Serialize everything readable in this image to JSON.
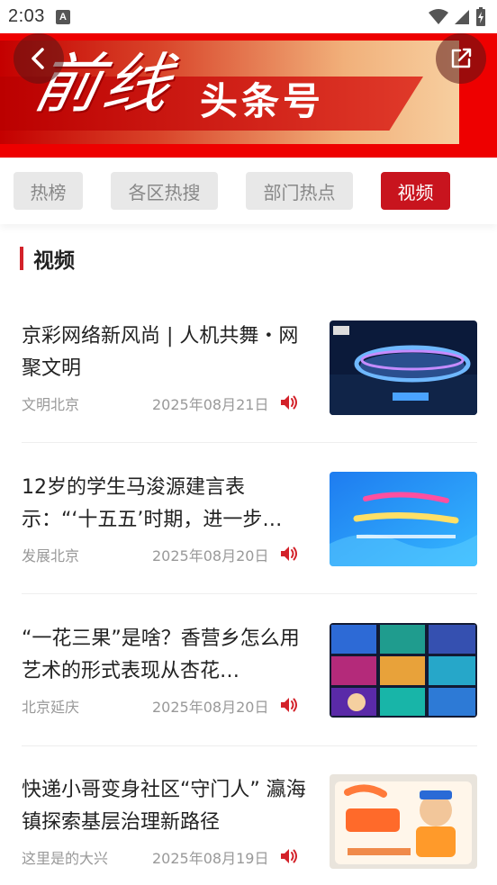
{
  "status_bar": {
    "time": "2:03",
    "a_badge": "A"
  },
  "banner": {
    "calligraphy": "前线",
    "title": "头条号"
  },
  "tabs": [
    {
      "label": "热榜",
      "active": false
    },
    {
      "label": "各区热搜",
      "active": false
    },
    {
      "label": "部门热点",
      "active": false
    },
    {
      "label": "视频",
      "active": true
    }
  ],
  "section": {
    "title": "视频"
  },
  "news": [
    {
      "title": "京彩网络新风尚 | 人机共舞・网聚文明",
      "source": "文明北京",
      "date": "2025年08月21日",
      "thumb": "stadium-night"
    },
    {
      "title": "12岁的学生马浚源建言表示：“‘十五五’时期，进一步…",
      "source": "发展北京",
      "date": "2025年08月20日",
      "thumb": "blue-poster"
    },
    {
      "title": "“一花三果”是啥？香营乡怎么用艺术的形式表现从杏花…",
      "source": "北京延庆",
      "date": "2025年08月20日",
      "thumb": "collage"
    },
    {
      "title": "快递小哥变身社区“守门人” 瀛海镇探索基层治理新路径",
      "source": "这里是的大兴",
      "date": "2025年08月19日",
      "thumb": "courier-poster"
    }
  ],
  "colors": {
    "brand_red": "#c8141e",
    "banner_red": "#ee0000",
    "tab_bg": "#e8e8e8"
  }
}
